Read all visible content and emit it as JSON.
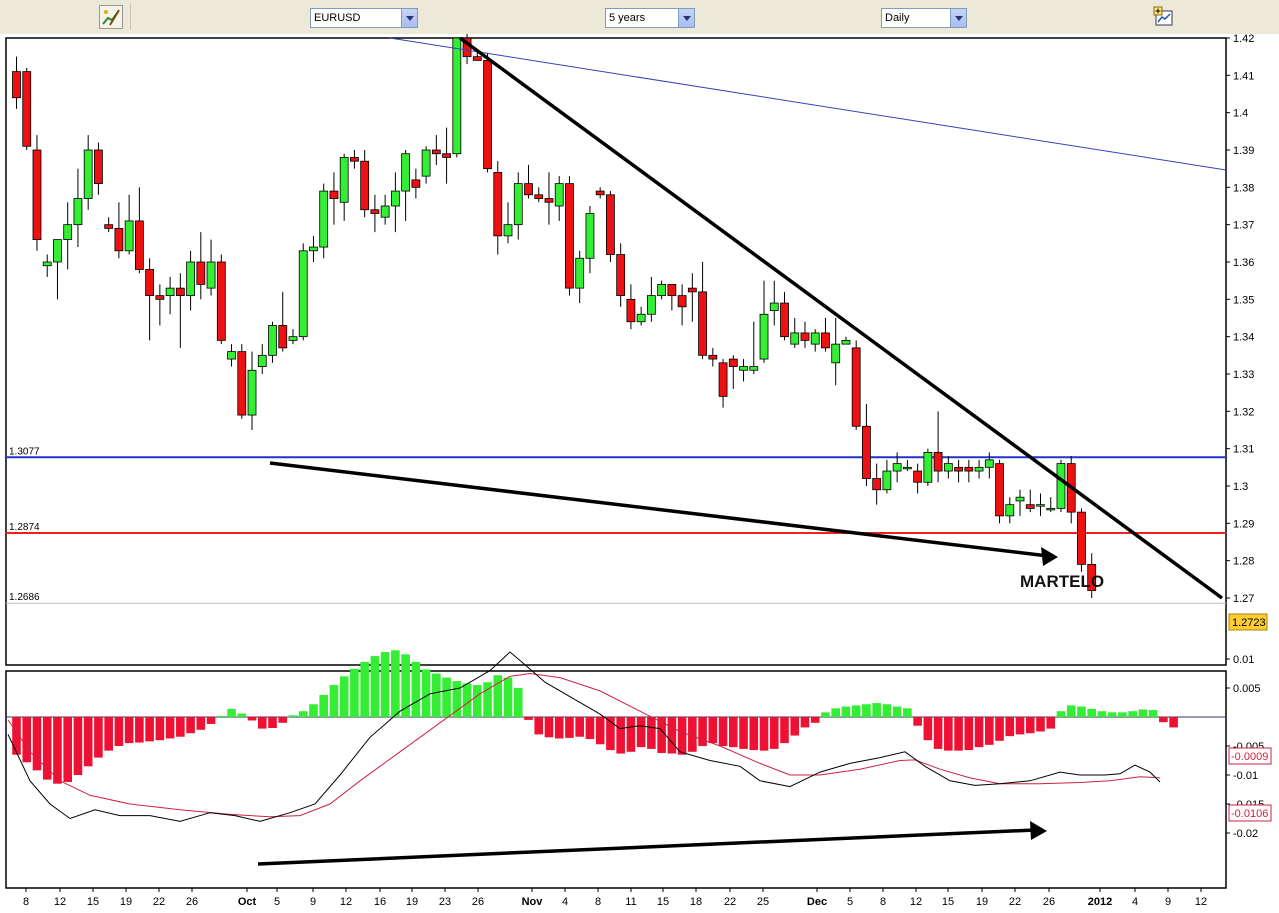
{
  "toolbar": {
    "symbol": {
      "value": "EURUSD"
    },
    "range": {
      "value": "5 years"
    },
    "interval": {
      "value": "Daily"
    }
  },
  "colors": {
    "up": "#33ee33",
    "down": "#ee1111",
    "hist_up": "#33ee33",
    "hist_down": "#ee1133",
    "macd": "#000000",
    "signal": "#cc2244",
    "blue_level": "#2233cc",
    "red_level": "#ee2222",
    "last_price_bg": "#ffcc33"
  },
  "chart_data": {
    "type": "candlestick",
    "symbol": "EURUSD",
    "interval": "Daily",
    "price_axis": {
      "ticks": [
        "1.42",
        "1.41",
        "1.4",
        "1.39",
        "1.38",
        "1.37",
        "1.36",
        "1.35",
        "1.34",
        "1.33",
        "1.32",
        "1.31",
        "1.3",
        "1.29",
        "1.28",
        "1.27"
      ],
      "range": [
        1.265,
        1.425
      ]
    },
    "date_axis": {
      "ticks": [
        "8",
        "12",
        "15",
        "19",
        "22",
        "26",
        "Oct",
        "5",
        "9",
        "12",
        "16",
        "19",
        "23",
        "26",
        "Nov",
        "4",
        "8",
        "11",
        "15",
        "18",
        "22",
        "25",
        "Dec",
        "5",
        "8",
        "12",
        "15",
        "19",
        "22",
        "26",
        "2012",
        "4",
        "9",
        "12"
      ]
    },
    "candles": [
      [
        1.411,
        1.415,
        1.401,
        1.404
      ],
      [
        1.411,
        1.412,
        1.39,
        1.391
      ],
      [
        1.39,
        1.394,
        1.363,
        1.366
      ],
      [
        1.359,
        1.362,
        1.356,
        1.36
      ],
      [
        1.36,
        1.365,
        1.35,
        1.366
      ],
      [
        1.366,
        1.376,
        1.358,
        1.37
      ],
      [
        1.37,
        1.385,
        1.364,
        1.377
      ],
      [
        1.377,
        1.394,
        1.374,
        1.39
      ],
      [
        1.39,
        1.392,
        1.378,
        1.381
      ],
      [
        1.37,
        1.372,
        1.368,
        1.369
      ],
      [
        1.369,
        1.376,
        1.361,
        1.363
      ],
      [
        1.363,
        1.378,
        1.362,
        1.371
      ],
      [
        1.371,
        1.38,
        1.357,
        1.358
      ],
      [
        1.358,
        1.361,
        1.339,
        1.351
      ],
      [
        1.351,
        1.354,
        1.343,
        1.35
      ],
      [
        1.351,
        1.356,
        1.346,
        1.353
      ],
      [
        1.353,
        1.357,
        1.337,
        1.351
      ],
      [
        1.351,
        1.363,
        1.347,
        1.36
      ],
      [
        1.36,
        1.368,
        1.35,
        1.354
      ],
      [
        1.353,
        1.366,
        1.351,
        1.36
      ],
      [
        1.36,
        1.362,
        1.338,
        1.339
      ],
      [
        1.334,
        1.338,
        1.332,
        1.336
      ],
      [
        1.336,
        1.338,
        1.318,
        1.319
      ],
      [
        1.319,
        1.336,
        1.315,
        1.331
      ],
      [
        1.332,
        1.338,
        1.33,
        1.335
      ],
      [
        1.335,
        1.344,
        1.333,
        1.343
      ],
      [
        1.343,
        1.352,
        1.336,
        1.337
      ],
      [
        1.339,
        1.342,
        1.338,
        1.34
      ],
      [
        1.34,
        1.365,
        1.339,
        1.363
      ],
      [
        1.363,
        1.367,
        1.36,
        1.364
      ],
      [
        1.364,
        1.381,
        1.361,
        1.379
      ],
      [
        1.379,
        1.384,
        1.37,
        1.377
      ],
      [
        1.376,
        1.389,
        1.371,
        1.388
      ],
      [
        1.388,
        1.39,
        1.385,
        1.387
      ],
      [
        1.387,
        1.39,
        1.372,
        1.374
      ],
      [
        1.374,
        1.378,
        1.368,
        1.373
      ],
      [
        1.372,
        1.378,
        1.37,
        1.375
      ],
      [
        1.375,
        1.384,
        1.368,
        1.379
      ],
      [
        1.379,
        1.39,
        1.371,
        1.389
      ],
      [
        1.382,
        1.385,
        1.377,
        1.38
      ],
      [
        1.383,
        1.391,
        1.381,
        1.39
      ],
      [
        1.39,
        1.394,
        1.386,
        1.389
      ],
      [
        1.389,
        1.396,
        1.381,
        1.388
      ],
      [
        1.389,
        1.411,
        1.388,
        1.42
      ],
      [
        1.42,
        1.422,
        1.413,
        1.415
      ],
      [
        1.415,
        1.417,
        1.414,
        1.414
      ],
      [
        1.414,
        1.416,
        1.384,
        1.385
      ],
      [
        1.384,
        1.387,
        1.362,
        1.367
      ],
      [
        1.367,
        1.376,
        1.365,
        1.37
      ],
      [
        1.37,
        1.384,
        1.366,
        1.381
      ],
      [
        1.381,
        1.386,
        1.377,
        1.378
      ],
      [
        1.378,
        1.38,
        1.376,
        1.377
      ],
      [
        1.377,
        1.384,
        1.37,
        1.376
      ],
      [
        1.375,
        1.383,
        1.371,
        1.381
      ],
      [
        1.381,
        1.383,
        1.351,
        1.353
      ],
      [
        1.353,
        1.363,
        1.349,
        1.361
      ],
      [
        1.361,
        1.375,
        1.357,
        1.373
      ],
      [
        1.379,
        1.38,
        1.377,
        1.378
      ],
      [
        1.378,
        1.379,
        1.36,
        1.362
      ],
      [
        1.362,
        1.365,
        1.348,
        1.351
      ],
      [
        1.35,
        1.354,
        1.342,
        1.344
      ],
      [
        1.344,
        1.348,
        1.343,
        1.346
      ],
      [
        1.346,
        1.356,
        1.344,
        1.351
      ],
      [
        1.351,
        1.355,
        1.35,
        1.354
      ],
      [
        1.354,
        1.354,
        1.347,
        1.351
      ],
      [
        1.351,
        1.354,
        1.343,
        1.348
      ],
      [
        1.353,
        1.357,
        1.344,
        1.352
      ],
      [
        1.352,
        1.36,
        1.334,
        1.335
      ],
      [
        1.335,
        1.337,
        1.332,
        1.334
      ],
      [
        1.333,
        1.334,
        1.321,
        1.324
      ],
      [
        1.334,
        1.335,
        1.326,
        1.332
      ],
      [
        1.331,
        1.334,
        1.328,
        1.332
      ],
      [
        1.331,
        1.344,
        1.33,
        1.332
      ],
      [
        1.334,
        1.355,
        1.333,
        1.346
      ],
      [
        1.347,
        1.355,
        1.343,
        1.349
      ],
      [
        1.349,
        1.352,
        1.339,
        1.34
      ],
      [
        1.338,
        1.345,
        1.337,
        1.341
      ],
      [
        1.341,
        1.344,
        1.337,
        1.339
      ],
      [
        1.338,
        1.342,
        1.336,
        1.341
      ],
      [
        1.341,
        1.345,
        1.336,
        1.337
      ],
      [
        1.333,
        1.345,
        1.327,
        1.338
      ],
      [
        1.338,
        1.34,
        1.338,
        1.339
      ],
      [
        1.337,
        1.339,
        1.315,
        1.316
      ],
      [
        1.316,
        1.322,
        1.3,
        1.302
      ],
      [
        1.302,
        1.306,
        1.295,
        1.299
      ],
      [
        1.299,
        1.307,
        1.298,
        1.304
      ],
      [
        1.304,
        1.309,
        1.301,
        1.306
      ],
      [
        1.305,
        1.307,
        1.304,
        1.305
      ],
      [
        1.304,
        1.306,
        1.298,
        1.301
      ],
      [
        1.301,
        1.31,
        1.3,
        1.309
      ],
      [
        1.309,
        1.32,
        1.301,
        1.304
      ],
      [
        1.304,
        1.308,
        1.302,
        1.306
      ],
      [
        1.305,
        1.307,
        1.301,
        1.304
      ],
      [
        1.305,
        1.307,
        1.301,
        1.304
      ],
      [
        1.304,
        1.307,
        1.302,
        1.305
      ],
      [
        1.305,
        1.309,
        1.302,
        1.307
      ],
      [
        1.306,
        1.307,
        1.29,
        1.292
      ],
      [
        1.292,
        1.297,
        1.29,
        1.295
      ],
      [
        1.296,
        1.299,
        1.292,
        1.297
      ],
      [
        1.295,
        1.299,
        1.293,
        1.294
      ],
      [
        1.295,
        1.298,
        1.292,
        1.295
      ],
      [
        1.294,
        1.297,
        1.293,
        1.294
      ],
      [
        1.294,
        1.307,
        1.293,
        1.306
      ],
      [
        1.306,
        1.308,
        1.29,
        1.293
      ],
      [
        1.293,
        1.294,
        1.277,
        1.279
      ],
      [
        1.279,
        1.282,
        1.27,
        1.272
      ]
    ],
    "levels": [
      {
        "value": 1.3077,
        "label": "1.3077"
      },
      {
        "value": 1.2874,
        "label": "1.2874"
      },
      {
        "value": 1.2686,
        "label": "1.2686"
      }
    ],
    "last_price": "1.2723",
    "annotations": [
      "MARTELO"
    ],
    "macd_axis": {
      "ticks": [
        "0.01",
        "0.005",
        "-0.005",
        "-0.01",
        "-0.015",
        "-0.02"
      ],
      "range": [
        -0.0215,
        0.012
      ]
    },
    "macd_labels": [
      "-0.0009",
      "-0.0106"
    ],
    "macd_hist": [
      -0.0065,
      -0.0078,
      -0.0092,
      -0.0108,
      -0.0115,
      -0.0112,
      -0.01,
      -0.0085,
      -0.007,
      -0.0058,
      -0.005,
      -0.0045,
      -0.0044,
      -0.0042,
      -0.004,
      -0.0037,
      -0.0034,
      -0.0028,
      -0.0022,
      -0.0012,
      0.0002,
      0.0014,
      0.0006,
      -0.0006,
      -0.002,
      -0.0019,
      -0.001,
      0.0003,
      0.001,
      0.0022,
      0.0038,
      0.0055,
      0.007,
      0.0083,
      0.0095,
      0.0105,
      0.0112,
      0.0115,
      0.0108,
      0.0095,
      0.0082,
      0.0075,
      0.0068,
      0.0062,
      0.0058,
      0.0055,
      0.006,
      0.0072,
      0.0068,
      0.005,
      -0.0005,
      -0.003,
      -0.0035,
      -0.0037,
      -0.0036,
      -0.0034,
      -0.0038,
      -0.0047,
      -0.0057,
      -0.0063,
      -0.006,
      -0.0052,
      -0.0055,
      -0.0062,
      -0.0063,
      -0.0065,
      -0.006,
      -0.005,
      -0.0045,
      -0.005,
      -0.0052,
      -0.0055,
      -0.0057,
      -0.0058,
      -0.0055,
      -0.0045,
      -0.0032,
      -0.0018,
      -0.001,
      0.0008,
      0.0015,
      0.0018,
      0.002,
      0.0022,
      0.0024,
      0.0022,
      0.0018,
      0.0015,
      -0.0015,
      -0.004,
      -0.0055,
      -0.0058,
      -0.0058,
      -0.0057,
      -0.0052,
      -0.0048,
      -0.0041,
      -0.0033,
      -0.003,
      -0.0028,
      -0.0025,
      -0.002,
      0.001,
      0.002,
      0.0018,
      0.0014,
      0.001,
      0.0008,
      0.0008,
      0.001,
      0.0013,
      0.0012,
      -0.0009,
      -0.0018
    ],
    "macd_line": [
      [
        8,
        -0.003
      ],
      [
        30,
        -0.011
      ],
      [
        50,
        -0.015
      ],
      [
        70,
        -0.0175
      ],
      [
        95,
        -0.016
      ],
      [
        120,
        -0.017
      ],
      [
        150,
        -0.017
      ],
      [
        180,
        -0.018
      ],
      [
        210,
        -0.0165
      ],
      [
        235,
        -0.017
      ],
      [
        260,
        -0.018
      ],
      [
        290,
        -0.0165
      ],
      [
        315,
        -0.015
      ],
      [
        340,
        -0.01
      ],
      [
        370,
        -0.0035
      ],
      [
        400,
        0.001
      ],
      [
        430,
        0.004
      ],
      [
        460,
        0.005
      ],
      [
        490,
        0.008
      ],
      [
        510,
        0.0112
      ],
      [
        525,
        0.009
      ],
      [
        545,
        0.006
      ],
      [
        570,
        0.0035
      ],
      [
        600,
        0.0005
      ],
      [
        620,
        -0.002
      ],
      [
        640,
        -0.0015
      ],
      [
        660,
        -0.002
      ],
      [
        680,
        -0.006
      ],
      [
        710,
        -0.0075
      ],
      [
        740,
        -0.0085
      ],
      [
        760,
        -0.011
      ],
      [
        790,
        -0.012
      ],
      [
        820,
        -0.0095
      ],
      [
        850,
        -0.008
      ],
      [
        880,
        -0.007
      ],
      [
        905,
        -0.006
      ],
      [
        925,
        -0.0085
      ],
      [
        950,
        -0.011
      ],
      [
        975,
        -0.0118
      ],
      [
        1000,
        -0.0115
      ],
      [
        1030,
        -0.011
      ],
      [
        1060,
        -0.0095
      ],
      [
        1080,
        -0.01
      ],
      [
        1105,
        -0.01
      ],
      [
        1120,
        -0.0098
      ],
      [
        1135,
        -0.0083
      ],
      [
        1150,
        -0.0095
      ],
      [
        1160,
        -0.0112
      ]
    ],
    "signal_line": [
      [
        8,
        -0.0005
      ],
      [
        30,
        -0.006
      ],
      [
        60,
        -0.011
      ],
      [
        90,
        -0.0135
      ],
      [
        130,
        -0.015
      ],
      [
        180,
        -0.016
      ],
      [
        230,
        -0.0168
      ],
      [
        270,
        -0.0172
      ],
      [
        300,
        -0.017
      ],
      [
        330,
        -0.015
      ],
      [
        360,
        -0.011
      ],
      [
        400,
        -0.006
      ],
      [
        440,
        -0.001
      ],
      [
        480,
        0.004
      ],
      [
        510,
        0.007
      ],
      [
        530,
        0.0075
      ],
      [
        560,
        0.0068
      ],
      [
        600,
        0.0045
      ],
      [
        640,
        0.001
      ],
      [
        680,
        -0.0025
      ],
      [
        720,
        -0.005
      ],
      [
        760,
        -0.008
      ],
      [
        790,
        -0.01
      ],
      [
        820,
        -0.01
      ],
      [
        860,
        -0.009
      ],
      [
        900,
        -0.0075
      ],
      [
        915,
        -0.0074
      ],
      [
        940,
        -0.009
      ],
      [
        970,
        -0.0105
      ],
      [
        1000,
        -0.0115
      ],
      [
        1040,
        -0.0115
      ],
      [
        1080,
        -0.0113
      ],
      [
        1110,
        -0.011
      ],
      [
        1140,
        -0.0103
      ],
      [
        1160,
        -0.0105
      ]
    ]
  }
}
